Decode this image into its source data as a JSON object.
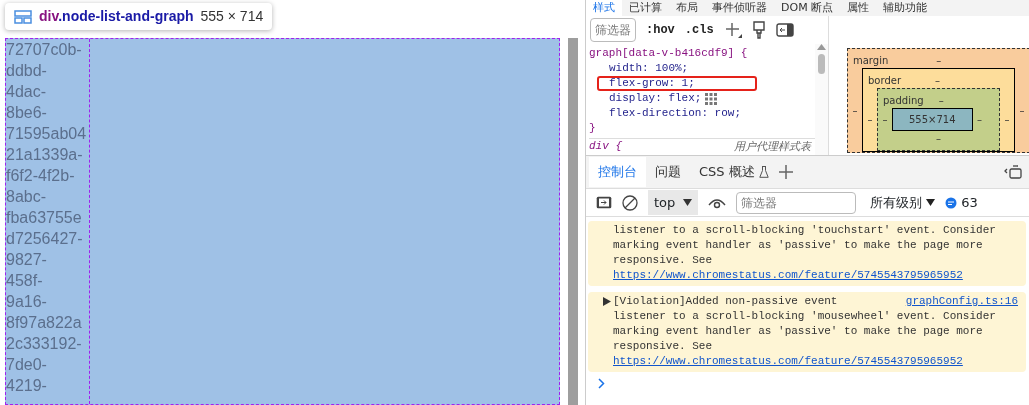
{
  "page": {
    "tooltip": {
      "tag": "div",
      "class_name": ".node-list-and-graph",
      "size": "555 × 714"
    },
    "node_list": [
      "72707c0b-",
      "ddbd-",
      "4dac-",
      "8be6-",
      "71595ab04",
      "21a1339a-",
      "f6f2-4f2b-",
      "8abc-",
      "fba63755e",
      "d7256427-",
      "9827-",
      "458f-",
      "9a16-",
      "8f97a822a",
      "2c333192-",
      "7de0-",
      "4219-"
    ]
  },
  "devtools": {
    "panel_tabs": [
      {
        "label": "样式",
        "selected": true
      },
      {
        "label": "已计算",
        "selected": false
      },
      {
        "label": "布局",
        "selected": false
      },
      {
        "label": "事件侦听器",
        "selected": false
      },
      {
        "label": "DOM 断点",
        "selected": false
      },
      {
        "label": "属性",
        "selected": false
      },
      {
        "label": "辅助功能",
        "selected": false
      }
    ],
    "styles_toolbar": {
      "filter_placeholder": "筛选器",
      "hov": ":hov",
      "cls": ".cls"
    },
    "rules": [
      {
        "selector": "graph[data-v-b416cdf9] {",
        "declarations": [
          {
            "text": "width: 100%;",
            "highlighted": false,
            "badge": false
          },
          {
            "text": "flex-grow: 1;",
            "highlighted": true,
            "badge": false
          },
          {
            "text": "display: flex;",
            "highlighted": false,
            "badge": true
          },
          {
            "text": "flex-direction: row;",
            "highlighted": false,
            "badge": false
          }
        ],
        "close": "}"
      },
      {
        "selector": "div {",
        "source": "用户代理样式表"
      }
    ],
    "box_model": {
      "margin": {
        "label": "margin",
        "top": "–",
        "left": "–",
        "right": "–"
      },
      "border": {
        "label": "border",
        "top": "–",
        "left": "–",
        "right": "–"
      },
      "padding": {
        "label": "padding",
        "top": "–",
        "left": "–",
        "right": "–",
        "bottom": "–"
      },
      "content": "555×714"
    },
    "drawer_tabs": [
      {
        "label": "控制台",
        "selected": true,
        "experimental": false
      },
      {
        "label": "问题",
        "selected": false,
        "experimental": false
      },
      {
        "label": "CSS 概述",
        "selected": false,
        "experimental": true
      }
    ],
    "console_toolbar": {
      "context": "top",
      "filter_placeholder": "筛选器",
      "levels": "所有级别",
      "message_count": "63"
    },
    "messages": [
      {
        "body": "listener to a scroll-blocking 'touchstart' event. Consider marking event handler as 'passive' to make the page more responsive. See",
        "link": "https://www.chromestatus.com/feature/5745543795965952"
      },
      {
        "title": "[Violation]Added non-passive event",
        "source": "graphConfig.ts:16",
        "body": "listener to a scroll-blocking 'mousewheel' event. Consider marking event handler as 'passive' to make the page more responsive. See",
        "link": "https://www.chromestatus.com/feature/5745543795965952"
      }
    ]
  }
}
